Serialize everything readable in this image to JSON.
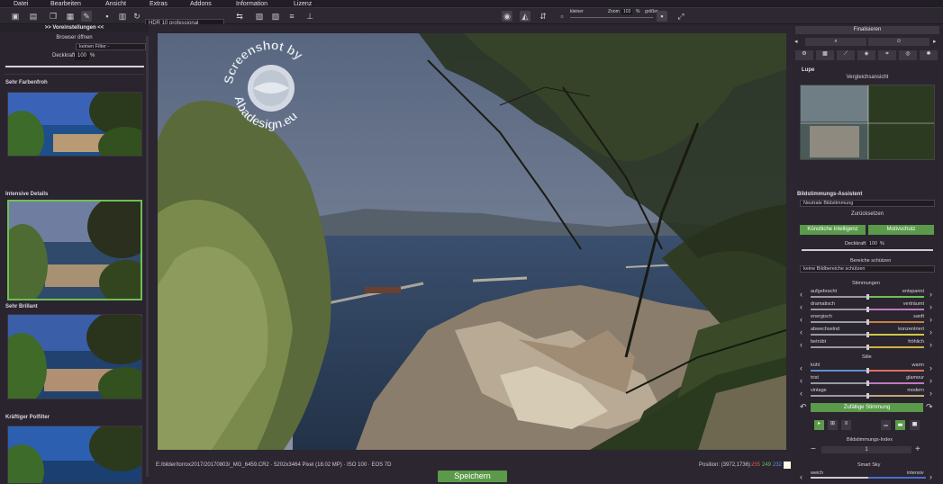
{
  "menu": [
    "Datei",
    "Bearbeiten",
    "Ansicht",
    "Extras",
    "Addons",
    "Information",
    "Lizenz"
  ],
  "toolbar": {
    "preset_select": "HDR 10 professional",
    "zoom_label": "Zoom",
    "zoom_value": "103",
    "zoom_unit": "%",
    "kleiner": "kleiner",
    "groesser": "größer"
  },
  "left": {
    "header": ">> Voreinstellungen <<",
    "browser": "Browser öffnen",
    "filter": "keinen Filter -",
    "deckkraft_label": "Deckkraft",
    "deckkraft_value": "100",
    "deckkraft_unit": "%",
    "presets": [
      "Sehr Farbenfroh",
      "Intensive Details",
      "Sehr Brillant",
      "Kräftiger Polfilter"
    ]
  },
  "status": {
    "path": "E:/bilder/torrox2017/20170803/_MG_6459.CR2 · 5202x3464 Pixel (18.02 MP) · ISO 100 · EOS 7D",
    "position": "Position: (3972,1736) ·",
    "r": "255",
    "g": "249",
    "b": "232"
  },
  "save": "Speichern",
  "right": {
    "finalisieren": "Finalisieren",
    "lupe": "Lupe",
    "vergleich": "Vergleichsansicht",
    "assistent": "Bildstimmungs-Assistent",
    "neutral": "Neutrale Bildstimmung",
    "zuruecksetzen": "Zurücksetzen",
    "ki": "Künstliche Intelligenz",
    "motivschutz": "Motivschutz",
    "deckkraft_label": "Deckkraft",
    "deckkraft_value": "100",
    "deckkraft_unit": "%",
    "bereiche": "Bereiche schützen",
    "keine": "keine Bildbereiche schützen",
    "stimmungen": "Stimmungen",
    "moods": [
      [
        "aufgebracht",
        "entspannt"
      ],
      [
        "dramatisch",
        "verträumt"
      ],
      [
        "energisch",
        "sanft"
      ],
      [
        "abwechselnd",
        "konzentriert"
      ],
      [
        "betrübt",
        "fröhlich"
      ]
    ],
    "stile": "Stile",
    "styles": [
      [
        "kühl",
        "warm"
      ],
      [
        "trist",
        "glamour"
      ],
      [
        "vintage",
        "modern"
      ]
    ],
    "zufaellig": "Zufällige Stimmung",
    "index": "Bildstimmungs-Index",
    "index_value": "1",
    "smart_sky": "Smart Sky",
    "weich": "weich",
    "intensiv": "intensiv"
  },
  "watermark": {
    "top": "Screenshot by",
    "bottom": "Abadesign.eu"
  }
}
